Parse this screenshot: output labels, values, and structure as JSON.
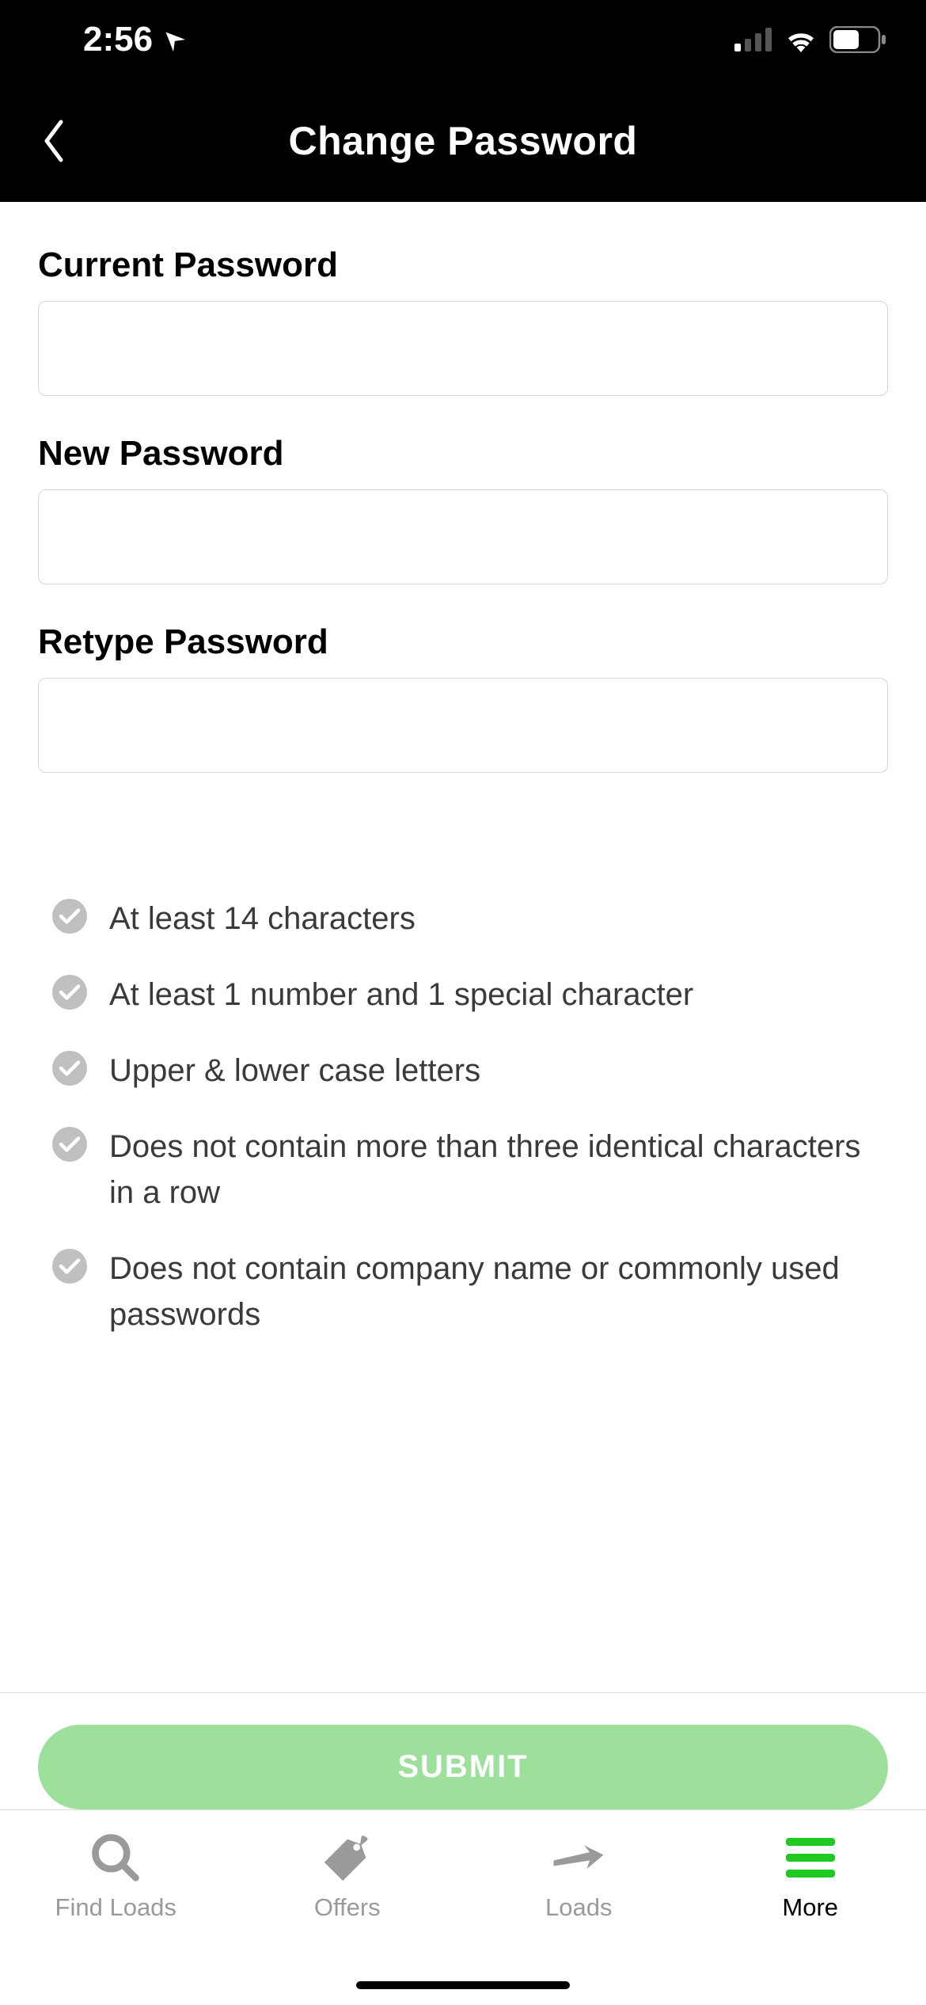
{
  "statusBar": {
    "time": "2:56"
  },
  "header": {
    "title": "Change Password"
  },
  "fields": {
    "currentPassword": {
      "label": "Current Password",
      "value": ""
    },
    "newPassword": {
      "label": "New Password",
      "value": ""
    },
    "retypePassword": {
      "label": "Retype Password",
      "value": ""
    }
  },
  "requirements": [
    "At least 14 characters",
    "At least 1 number and 1 special character",
    "Upper & lower case letters",
    "Does not contain more than three identical characters in a row",
    "Does not contain company name or commonly used passwords"
  ],
  "submit": {
    "label": "SUBMIT"
  },
  "tabs": {
    "findLoads": "Find Loads",
    "offers": "Offers",
    "loads": "Loads",
    "more": "More"
  }
}
